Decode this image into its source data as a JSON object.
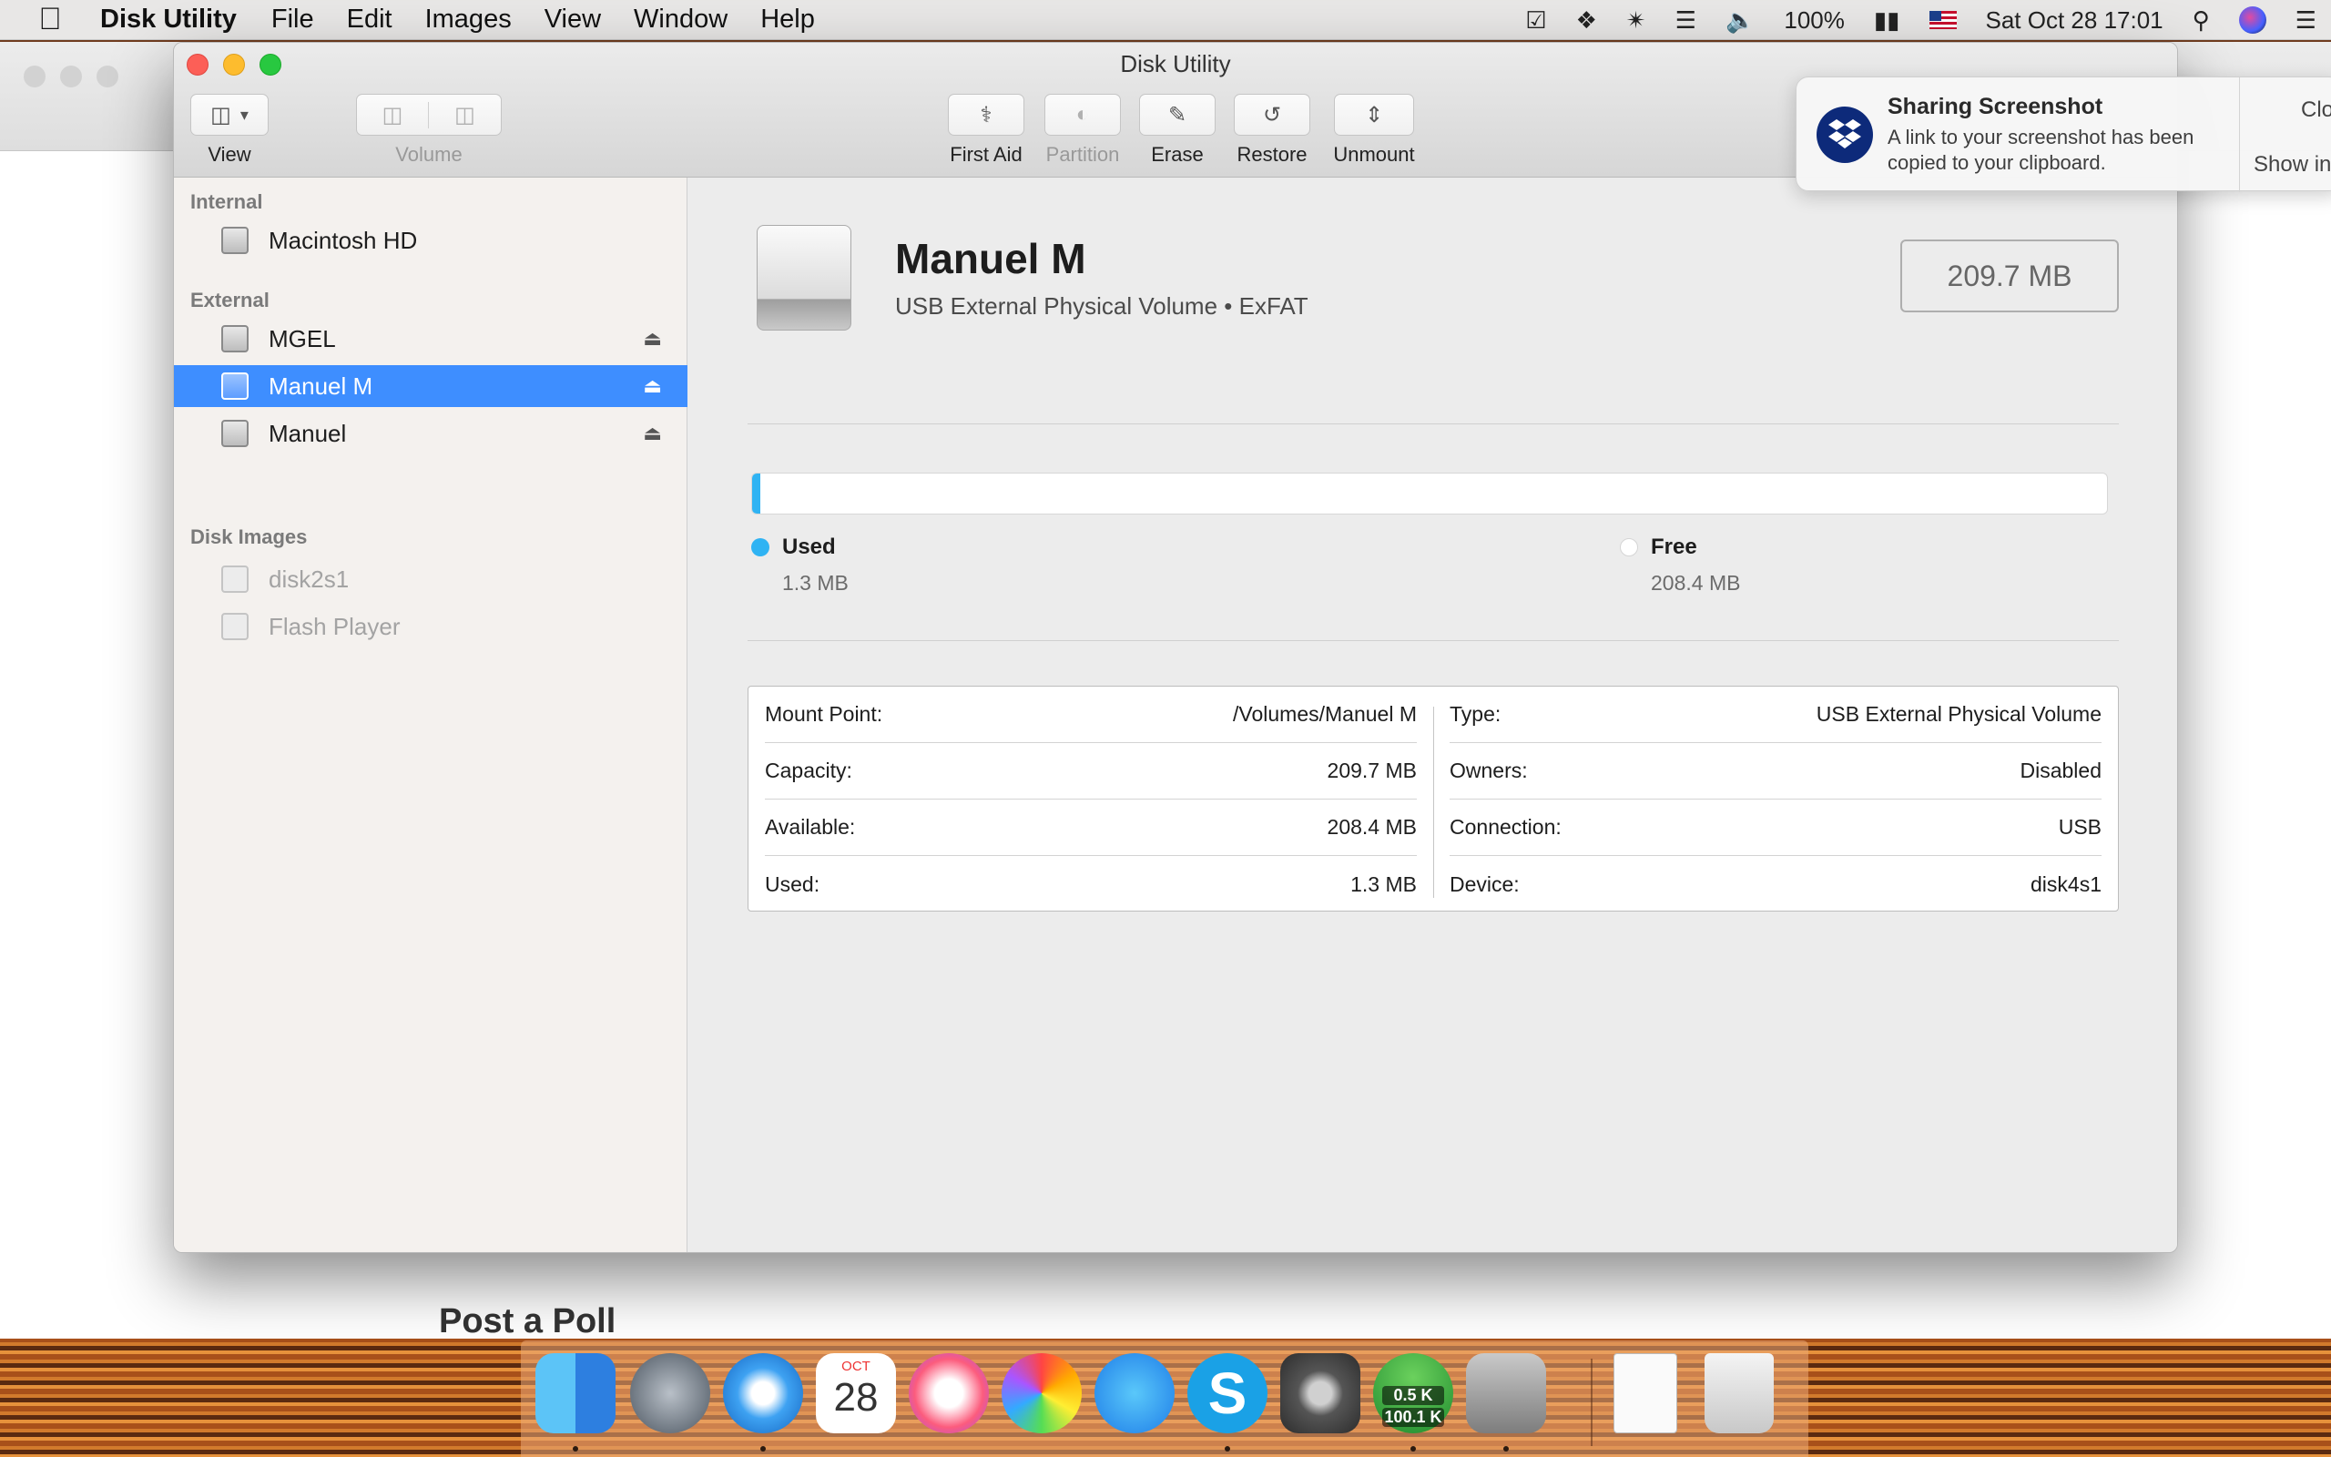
{
  "menubar": {
    "app_name": "Disk Utility",
    "items": [
      "File",
      "Edit",
      "Images",
      "View",
      "Window",
      "Help"
    ],
    "battery": "100%",
    "datetime": "Sat Oct 28  17:01"
  },
  "background_page": {
    "heading": "Post a Poll"
  },
  "window": {
    "title": "Disk Utility",
    "toolbar": {
      "view_label": "View",
      "volume_label": "Volume",
      "first_aid_label": "First Aid",
      "partition_label": "Partition",
      "erase_label": "Erase",
      "restore_label": "Restore",
      "unmount_label": "Unmount"
    },
    "sidebar": {
      "internal_header": "Internal",
      "internal_items": [
        {
          "label": "Macintosh HD"
        }
      ],
      "external_header": "External",
      "external_items": [
        {
          "label": "MGEL"
        },
        {
          "label": "Manuel M"
        },
        {
          "label": "Manuel"
        }
      ],
      "images_header": "Disk Images",
      "image_items": [
        {
          "label": "disk2s1"
        },
        {
          "label": "Flash Player"
        }
      ]
    },
    "volume": {
      "name": "Manuel M",
      "description": "USB External Physical Volume • ExFAT",
      "size": "209.7 MB",
      "used_fraction": 0.0062,
      "used_label": "Used",
      "used_value": "1.3 MB",
      "free_label": "Free",
      "free_value": "208.4 MB",
      "used_color": "#2fb3f3",
      "free_color": "#ffffff"
    },
    "info": {
      "left": [
        {
          "key": "Mount Point:",
          "value": "/Volumes/Manuel M"
        },
        {
          "key": "Capacity:",
          "value": "209.7 MB"
        },
        {
          "key": "Available:",
          "value": "208.4 MB"
        },
        {
          "key": "Used:",
          "value": "1.3 MB"
        }
      ],
      "right": [
        {
          "key": "Type:",
          "value": "USB External Physical Volume"
        },
        {
          "key": "Owners:",
          "value": "Disabled"
        },
        {
          "key": "Connection:",
          "value": "USB"
        },
        {
          "key": "Device:",
          "value": "disk4s1"
        }
      ]
    }
  },
  "notification": {
    "title": "Sharing Screenshot",
    "body": "A link to your screenshot has been copied to your clipboard.",
    "close_label": "Clo",
    "show_label": "Show in"
  },
  "dock": {
    "apps": [
      "finder-icon",
      "launchpad-icon",
      "safari-icon",
      "calendar-icon",
      "itunes-icon",
      "photos-icon",
      "messages-icon",
      "skype-icon",
      "system-preferences-icon",
      "network-monitor-icon",
      "disk-utility-icon",
      "pdf-document-icon",
      "trash-icon"
    ],
    "calendar_month": "OCT",
    "calendar_day": "28",
    "net_up": "0.5 K",
    "net_down": "100.1 K"
  }
}
